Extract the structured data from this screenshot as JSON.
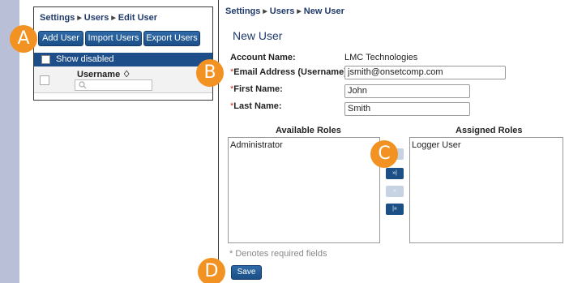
{
  "left_panel": {
    "breadcrumb": [
      "Settings",
      "Users",
      "Edit User"
    ],
    "buttons": {
      "add": "Add User",
      "import": "Import Users",
      "export": "Export Users"
    },
    "show_disabled": "Show disabled",
    "column_username": "Username ♢"
  },
  "right_panel": {
    "breadcrumb": [
      "Settings",
      "Users",
      "New User"
    ],
    "title": "New User",
    "account_name_label": "Account Name:",
    "account_name_value": "LMC Technologies",
    "email_label": "Email Address (Username):",
    "email_value": "jsmith@onsetcomp.com",
    "first_name_label": "First Name:",
    "first_name_value": "John",
    "last_name_label": "Last Name:",
    "last_name_value": "Smith",
    "required_mark": "*",
    "available_roles_title": "Available Roles",
    "assigned_roles_title": "Assigned Roles",
    "available_roles": [
      "Administrator"
    ],
    "assigned_roles": [
      "Logger User"
    ],
    "arrows": [
      {
        "glyph": "»",
        "enabled": false
      },
      {
        "glyph": "»|",
        "enabled": true
      },
      {
        "glyph": "«",
        "enabled": false
      },
      {
        "glyph": "|«",
        "enabled": true
      }
    ],
    "required_note": "* Denotes required fields",
    "save_label": "Save"
  },
  "callouts": {
    "a": "A",
    "b": "B",
    "c": "C",
    "d": "D"
  },
  "colors": {
    "accent": "#1d4e8a",
    "callout": "#f29222",
    "required": "#c0392b"
  }
}
